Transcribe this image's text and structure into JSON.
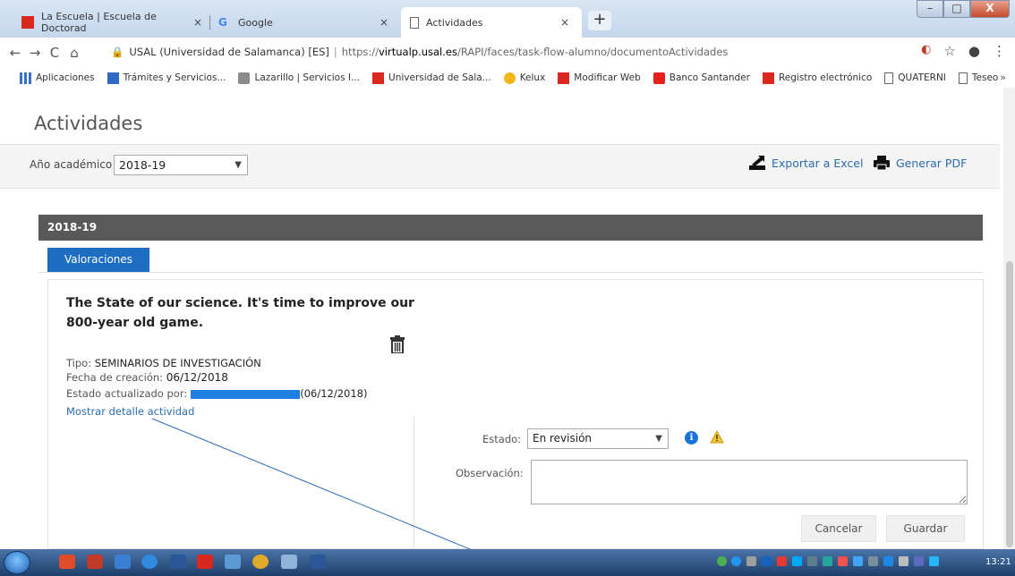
{
  "browser": {
    "tabs": [
      {
        "label": "La Escuela | Escuela de Doctorad",
        "icon": "usal-icon",
        "close": "×"
      },
      {
        "label": "Google",
        "icon": "google-icon",
        "close": "×"
      },
      {
        "label": "Actividades",
        "icon": "page-icon",
        "close": "×"
      }
    ],
    "new_tab": "+",
    "window_buttons": {
      "minimize": "–",
      "maximize": "□",
      "close": "X"
    },
    "nav": {
      "back": "←",
      "forward": "→",
      "reload": "C",
      "home": "⌂"
    },
    "address": {
      "site": "USAL (Universidad de Salamanca) [ES]",
      "scheme": "https://",
      "host": "virtualp.usal.es",
      "path": "/RAPI/faces/task-flow-alumno/documentoActividades"
    },
    "bookmarks": [
      {
        "label": "Aplicaciones",
        "icon": "apps-icon"
      },
      {
        "label": "Trámites y Servicios...",
        "icon": "tramites-icon"
      },
      {
        "label": "Lazarillo | Servicios I...",
        "icon": "lazarillo-icon"
      },
      {
        "label": "Universidad de Sala...",
        "icon": "usal-icon"
      },
      {
        "label": "Kelux",
        "icon": "kelux-icon"
      },
      {
        "label": "Modificar Web",
        "icon": "usal-icon"
      },
      {
        "label": "Banco Santander",
        "icon": "santander-icon"
      },
      {
        "label": "Registro electrónico",
        "icon": "usal-icon"
      },
      {
        "label": "QUATERNI",
        "icon": "page-icon"
      },
      {
        "label": "Teseo",
        "icon": "page-icon"
      }
    ],
    "bookmarks_more": "»"
  },
  "page": {
    "title": "Actividades",
    "filter": {
      "year_label": "Año académico",
      "year_value": "2018-19",
      "export_label": "Exportar a Excel",
      "pdf_label": "Generar PDF"
    },
    "section_title": "2018-19",
    "tab_label": "Valoraciones",
    "activity": {
      "title": "The State of our science. It's time to improve our 800-year old game.",
      "tipo_label": "Tipo:",
      "tipo_value": "SEMINARIOS DE INVESTIGACIÓN",
      "fecha_label": "Fecha de creación:",
      "fecha_value": "06/12/2018",
      "estado_por_label": "Estado actualizado por:",
      "estado_por_date": "(06/12/2018)",
      "detail_link": "Mostrar detalle actividad"
    },
    "form": {
      "estado_label": "Estado:",
      "estado_value": "En revisión",
      "observacion_label": "Observación:",
      "observacion_value": "",
      "cancel_label": "Cancelar",
      "save_label": "Guardar"
    }
  },
  "taskbar": {
    "clock": "13:21"
  },
  "colors": {
    "link": "#2b6cb0",
    "tab_active": "#1d6ec2",
    "section_bar": "#595959",
    "redaction": "#1f7fe0"
  }
}
